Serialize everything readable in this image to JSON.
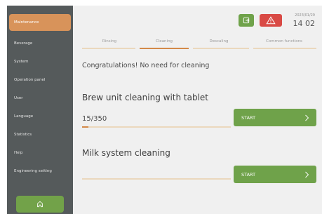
{
  "sidebar": {
    "items": [
      {
        "label": "Maintenance",
        "active": true
      },
      {
        "label": "Beverage"
      },
      {
        "label": "System"
      },
      {
        "label": "Operation panel"
      },
      {
        "label": "User"
      },
      {
        "label": "Language"
      },
      {
        "label": "Statistics"
      },
      {
        "label": "Help"
      },
      {
        "label": "Engineering setting"
      }
    ],
    "home_icon": "home-icon"
  },
  "header": {
    "date": "2023/01/29",
    "time": "14 02",
    "logout_icon": "logout-icon",
    "alert_icon": "warning-icon"
  },
  "tabs": [
    {
      "label": "Rinsing"
    },
    {
      "label": "Cleaning",
      "active": true
    },
    {
      "label": "Descaling"
    },
    {
      "label": "Common functions"
    }
  ],
  "main": {
    "message": "Congratulations! No need for cleaning",
    "brew": {
      "title": "Brew unit cleaning with tablet",
      "counter": "15/350",
      "progress": 0.043,
      "start_label": "START"
    },
    "milk": {
      "title": "Milk system cleaning",
      "progress": 0,
      "start_label": "START"
    }
  },
  "colors": {
    "accent": "#d38a49",
    "green": "#6fa24a",
    "red": "#d94a45",
    "sidebar": "#555a5b"
  }
}
